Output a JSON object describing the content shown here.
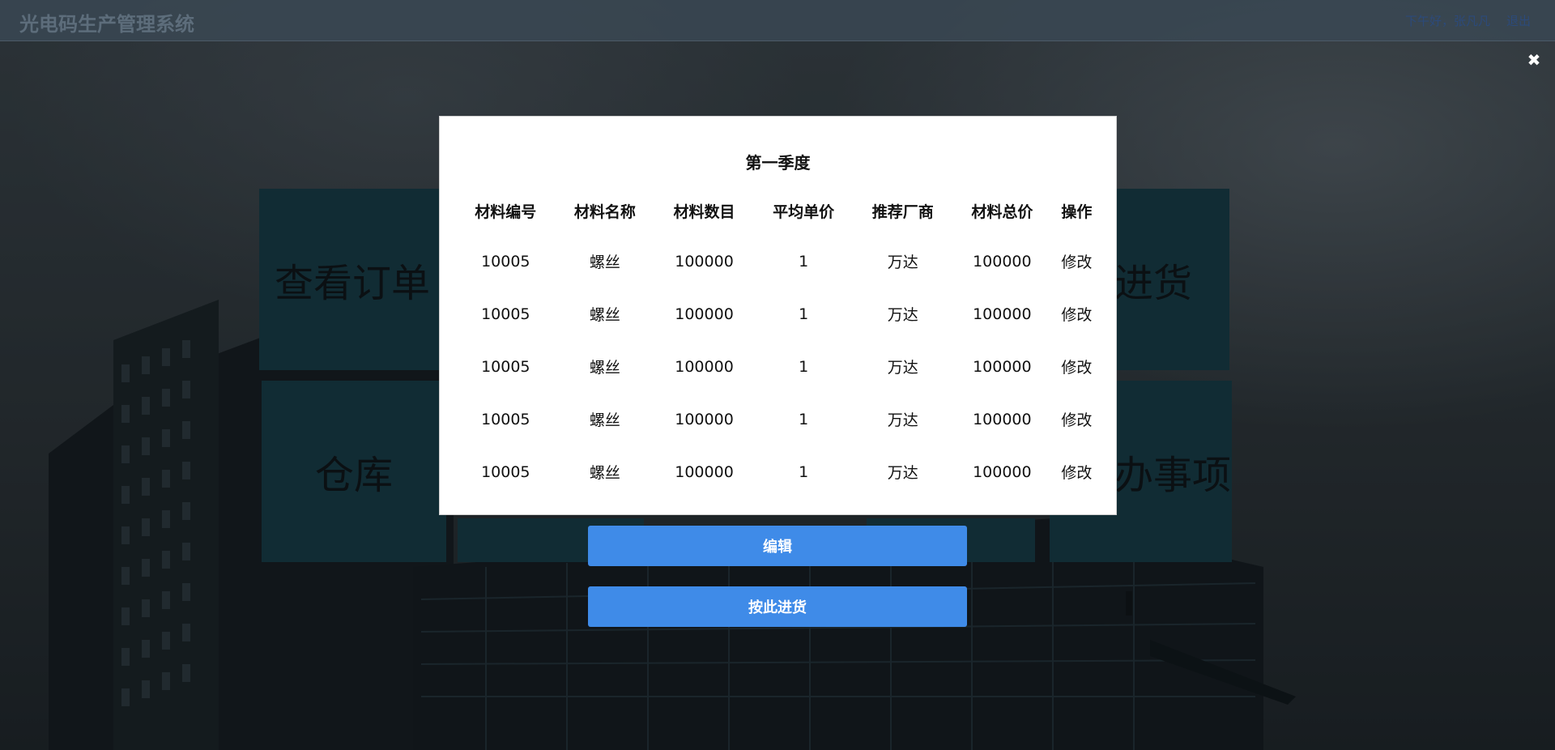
{
  "header": {
    "app_title": "光电码生产管理系统",
    "greeting": "下午好，张凡凡",
    "logout": "退出"
  },
  "tiles": {
    "view_orders": "查看订单",
    "purchase": "进货",
    "warehouse": "仓库",
    "todo": "办事项"
  },
  "modal": {
    "close_icon": "close-icon",
    "title": "第一季度",
    "columns": [
      "材料编号",
      "材料名称",
      "材料数目",
      "平均单价",
      "推荐厂商",
      "材料总价",
      "操作"
    ],
    "rows": [
      [
        "10005",
        "螺丝",
        "100000",
        "1",
        "万达",
        "100000",
        "修改"
      ],
      [
        "10005",
        "螺丝",
        "100000",
        "1",
        "万达",
        "100000",
        "修改"
      ],
      [
        "10005",
        "螺丝",
        "100000",
        "1",
        "万达",
        "100000",
        "修改"
      ],
      [
        "10005",
        "螺丝",
        "100000",
        "1",
        "万达",
        "100000",
        "修改"
      ],
      [
        "10005",
        "螺丝",
        "100000",
        "1",
        "万达",
        "100000",
        "修改"
      ]
    ]
  },
  "buttons": {
    "edit": "编辑",
    "stock_by_this": "按此进货"
  },
  "colors": {
    "button_blue": "#3f8be8",
    "tile_teal": "#163c47",
    "header_bg": "#3a4854"
  }
}
